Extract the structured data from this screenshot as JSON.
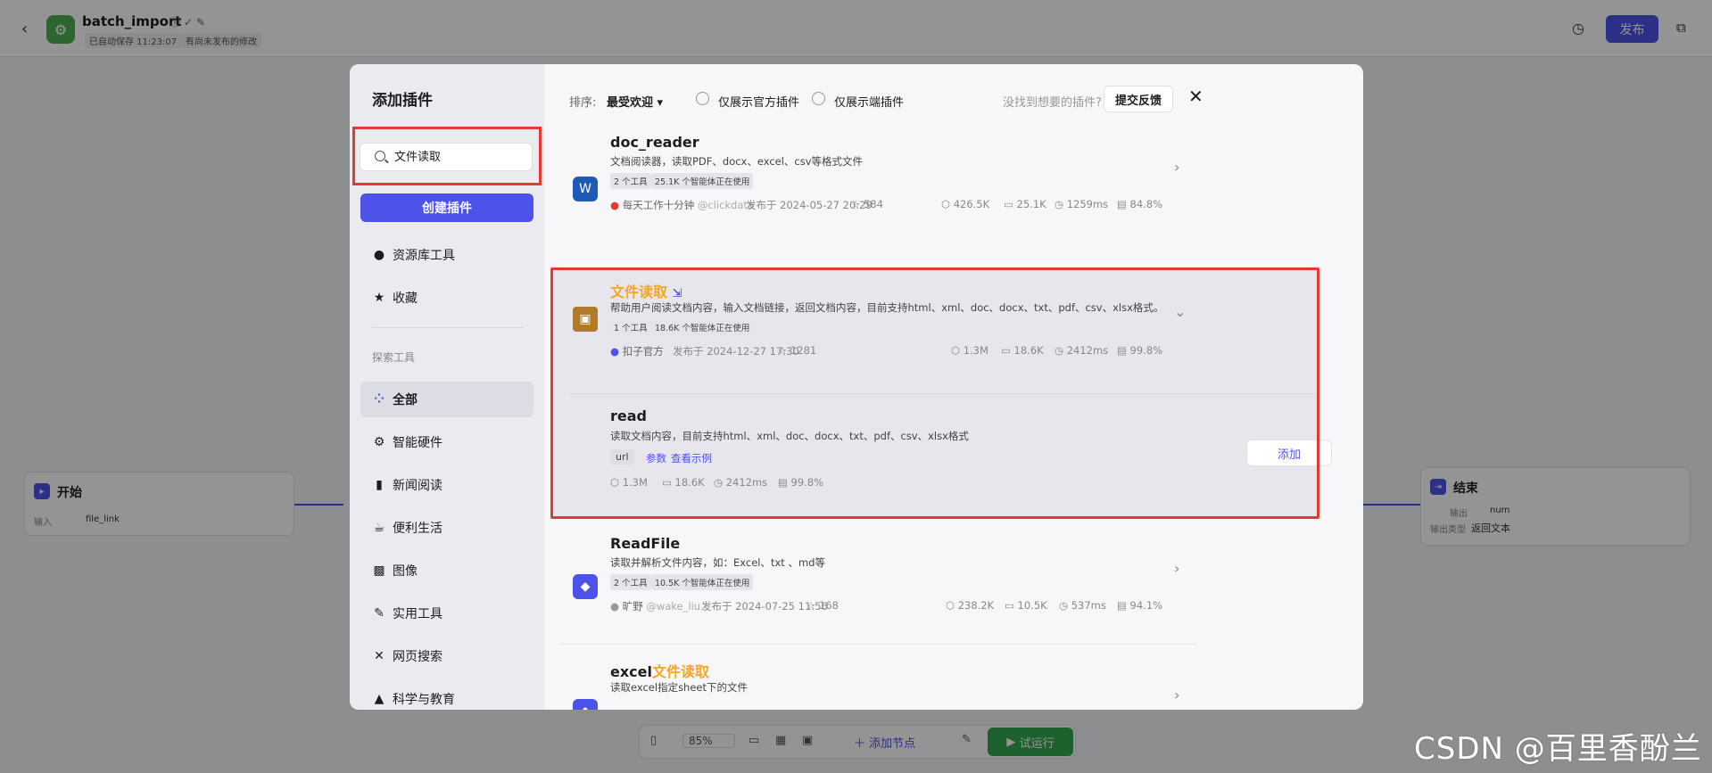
{
  "app": {
    "title": "batch_import",
    "autosave": "已自动保存 11:23:07",
    "unpublished": "有尚未发布的修改",
    "publish_label": "发布"
  },
  "canvas": {
    "start_node": {
      "title": "开始",
      "input_label": "输入",
      "input_value": "file_link"
    },
    "end_node": {
      "title": "结束",
      "output_label": "输出",
      "output_var": "num",
      "output_type_label": "输出类型",
      "output_type": "返回文本"
    },
    "toolbar": {
      "zoom": "85%",
      "add_node": "添加节点",
      "run": "试运行"
    }
  },
  "modal": {
    "title": "添加插件",
    "search_value": "文件读取",
    "create_label": "创建插件",
    "nav_top": [
      {
        "label": "资源库工具",
        "icon": "user-icon"
      },
      {
        "label": "收藏",
        "icon": "star-icon"
      }
    ],
    "section_label": "探索工具",
    "nav_categories": [
      {
        "label": "全部",
        "icon": "grid-icon",
        "active": true
      },
      {
        "label": "智能硬件",
        "icon": "gear-icon"
      },
      {
        "label": "新闻阅读",
        "icon": "book-icon"
      },
      {
        "label": "便利生活",
        "icon": "cup-icon"
      },
      {
        "label": "图像",
        "icon": "image-icon"
      },
      {
        "label": "实用工具",
        "icon": "wrench-icon"
      },
      {
        "label": "网页搜索",
        "icon": "network-icon"
      },
      {
        "label": "科学与教育",
        "icon": "cap-icon"
      }
    ],
    "sort_label": "排序:",
    "sort_value": "最受欢迎",
    "filter_official": "仅展示官方插件",
    "filter_client": "仅展示端插件",
    "feedback_question": "没找到想要的插件?",
    "feedback_label": "提交反馈",
    "plugins": [
      {
        "name": "doc_reader",
        "desc": "文档阅读器，读取PDF、docx、excel、csv等格式文件",
        "tools": "2 个工具",
        "agents": "25.1K 个智能体正在使用",
        "author": "每天工作十分钟",
        "handle": "@clickdata",
        "published": "发布于 2024-05-27 20:29",
        "stars": "584",
        "calls": "426.5K",
        "bots": "25.1K",
        "latency": "1259ms",
        "success": "84.8%"
      },
      {
        "name": "文件读取",
        "desc": "帮助用户阅读文档内容，输入文档链接，返回文档内容，目前支持html、xml、doc、docx、txt、pdf、csv、xlsx格式。",
        "tools": "1 个工具",
        "agents": "18.6K 个智能体正在使用",
        "author": "扣子官方",
        "published": "发布于 2024-12-27 17:30",
        "stars": "1281",
        "calls": "1.3M",
        "bots": "18.6K",
        "latency": "2412ms",
        "success": "99.8%",
        "tool": {
          "name": "read",
          "desc": "读取文档内容，目前支持html、xml、doc、docx、txt、pdf、csv、xlsx格式",
          "param": "url",
          "params_link": "参数",
          "example_link": "查看示例",
          "calls": "1.3M",
          "bots": "18.6K",
          "latency": "2412ms",
          "success": "99.8%",
          "add_label": "添加"
        }
      },
      {
        "name": "ReadFile",
        "desc": "读取并解析文件内容，如：Excel、txt 、md等",
        "tools": "2 个工具",
        "agents": "10.5K 个智能体正在使用",
        "author": "旷野",
        "handle": "@wake_liu",
        "published": "发布于 2024-07-25 11:56",
        "stars": "168",
        "calls": "238.2K",
        "bots": "10.5K",
        "latency": "537ms",
        "success": "94.1%"
      },
      {
        "name_prefix": "excel",
        "name_highlight": "文件读取",
        "desc": "读取excel指定sheet下的文件"
      }
    ]
  },
  "watermark": "CSDN @百里香酚兰",
  "colors": {
    "accent": "#4d53e8",
    "highlight": "#f5a623",
    "annotation": "#e53935"
  }
}
